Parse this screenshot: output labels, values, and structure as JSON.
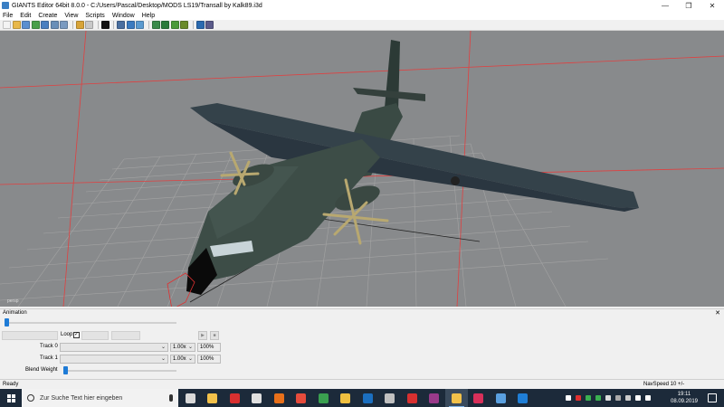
{
  "window": {
    "title": "GIANTS Editor 64bit 8.0.0 - C:/Users/Pascal/Desktop/MODS LS19/Transall by Kalk89.i3d",
    "minimize_glyph": "—",
    "maximize_glyph": "❐",
    "close_glyph": "✕"
  },
  "menu": {
    "items": [
      "File",
      "Edit",
      "Create",
      "View",
      "Scripts",
      "Window",
      "Help"
    ]
  },
  "toolbar": {
    "icons": [
      {
        "name": "new-file-icon",
        "color": "#f3f3f3"
      },
      {
        "name": "open-folder-icon",
        "color": "#e8b84a"
      },
      {
        "name": "save-icon",
        "color": "#5b8fd0"
      },
      {
        "name": "refresh-icon",
        "color": "#4aa04a"
      },
      {
        "name": "save-all-icon",
        "color": "#4a7fc0"
      },
      {
        "name": "export-icon",
        "color": "#6a8fb8"
      },
      {
        "name": "import-icon",
        "color": "#7a9ac0"
      },
      {
        "name": "undo-icon",
        "color": "#d8a438"
      },
      {
        "name": "redo-icon",
        "color": "#c8c8c8"
      },
      {
        "name": "play-icon",
        "color": "#111111"
      },
      {
        "name": "select-icon",
        "color": "#4a6fa0"
      },
      {
        "name": "move-icon",
        "color": "#3a7ac0"
      },
      {
        "name": "rotate-icon",
        "color": "#5a9ad0"
      },
      {
        "name": "terrain-icon",
        "color": "#3a8a4a"
      },
      {
        "name": "paint-icon",
        "color": "#2a7a3a"
      },
      {
        "name": "foliage-icon",
        "color": "#4a9a3a"
      },
      {
        "name": "decal-icon",
        "color": "#6a8a2a"
      },
      {
        "name": "settings-gear-icon",
        "color": "#2a6ab0"
      },
      {
        "name": "tools-gear-icon",
        "color": "#5a5a8a"
      }
    ]
  },
  "viewport": {
    "camera_label": "persp",
    "background": "#888a8c",
    "grid_color": "#a0a0a0",
    "axis_color": "#e03030"
  },
  "animation": {
    "panel_title": "Animation",
    "close_glyph": "✕",
    "timeline_position": 0,
    "loop_label": "Loop",
    "loop_checked_glyph": "✓",
    "play_glyph": "▶",
    "stop_glyph": "■",
    "tracks": [
      {
        "label": "Track 0",
        "speed": "1.00x",
        "weight": "100%"
      },
      {
        "label": "Track 1",
        "speed": "1.00x",
        "weight": "100%"
      }
    ],
    "dropdown_arrow": "⌄",
    "blend_weight_label": "Blend Weight",
    "blend_weight_position": 0
  },
  "status": {
    "left": "Ready",
    "right": "NavSpeed 10 +/-"
  },
  "taskbar": {
    "search_placeholder": "Zur Suche Text hier eingeben",
    "apps": [
      {
        "name": "task-view-icon",
        "color": "#d9d9d9",
        "active": false
      },
      {
        "name": "file-explorer-icon",
        "color": "#f2c14a",
        "active": false
      },
      {
        "name": "app-red-icon",
        "color": "#d93030",
        "active": false
      },
      {
        "name": "store-icon",
        "color": "#e0e0e0",
        "active": false
      },
      {
        "name": "firefox-icon",
        "color": "#e8701a",
        "active": false
      },
      {
        "name": "chrome-icon",
        "color": "#e74c3c",
        "active": false
      },
      {
        "name": "game-icon",
        "color": "#3aa050",
        "active": false
      },
      {
        "name": "game-launcher-icon",
        "color": "#f0c040",
        "active": false
      },
      {
        "name": "steam-icon",
        "color": "#1b6fc0",
        "active": false
      },
      {
        "name": "media-icon",
        "color": "#c0c0c0",
        "active": false
      },
      {
        "name": "app-red2-icon",
        "color": "#d83030",
        "active": false
      },
      {
        "name": "winrar-icon",
        "color": "#9a3a8a",
        "active": false
      },
      {
        "name": "giants-editor-icon",
        "color": "#f2c14a",
        "active": true
      },
      {
        "name": "dice-icon",
        "color": "#d8305a",
        "active": false
      },
      {
        "name": "photos-icon",
        "color": "#5aa0e0",
        "active": false
      },
      {
        "name": "edge-icon",
        "color": "#1f7ed6",
        "active": false
      }
    ],
    "tray_icons": [
      {
        "name": "up-arrow-icon",
        "color": "#ffffff"
      },
      {
        "name": "tray-app-icon",
        "color": "#e03030"
      },
      {
        "name": "tray-green-icon",
        "color": "#3ab050"
      },
      {
        "name": "tray-green2-icon",
        "color": "#3ab050"
      },
      {
        "name": "tray-bird-icon",
        "color": "#dddddd"
      },
      {
        "name": "tray-game-icon",
        "color": "#aaaaaa"
      },
      {
        "name": "tray-grey-icon",
        "color": "#cccccc"
      },
      {
        "name": "network-icon",
        "color": "#ffffff"
      },
      {
        "name": "volume-icon",
        "color": "#ffffff"
      }
    ],
    "time": "19:11",
    "date": "08.09.2019"
  }
}
